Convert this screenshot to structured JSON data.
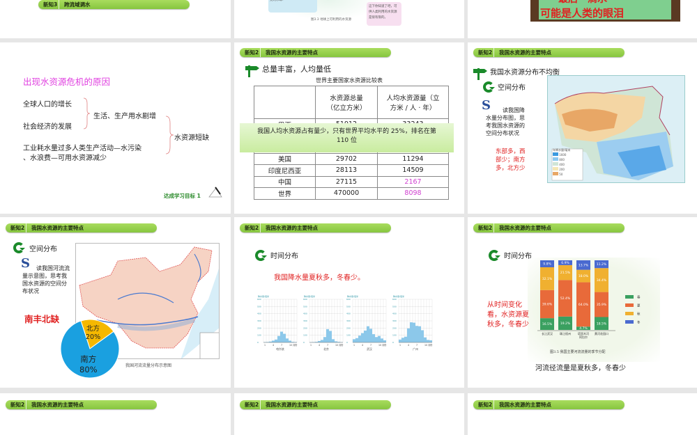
{
  "colors": {
    "pill": "#92d050",
    "accent_red": "#e02020",
    "title_pink": "#e040e0",
    "magenta": "#d040d0",
    "north": "#f5b800",
    "south": "#1aa0e0"
  },
  "top_row": {
    "slide1": {
      "section_num": "新知3",
      "section_title": "跨流域调水"
    },
    "slide2": {
      "bubble_blue": "千米的水，是蔚蓝色宝石一样漂亮的水球!",
      "bubble_pink": "这下你知道了吧，可供人类利用的水资源是很有限的。",
      "caption": "图3.3 地球上可利用的水资源"
    },
    "slide3": {
      "photo_line1": "最后一滴水",
      "photo_line2": "可能是人类的眼泪"
    }
  },
  "header": {
    "section_num": "新知2",
    "section_title": "我国水资源的主要特点"
  },
  "crisis": {
    "title": "出现水资源危机的原因",
    "cause1": "全球人口的增长",
    "cause2": "社会经济的发展",
    "result1": "生活、生产用水剧增",
    "cause3a": "工业耗水量过多人类生产活动—水污染",
    "cause3b": "、水浪费—可用水资源减少",
    "result2": "水资源短缺",
    "footer": "达成学习目标",
    "footer_num": "1"
  },
  "total": {
    "heading": "总量丰富，人均量低",
    "caption": "世界主要国家水资源比较表",
    "col1": "水资源总量（亿立方米）",
    "col2": "人均水资源量（立方米 / 人 · 年）",
    "rows": [
      {
        "c": "巴西",
        "t": "51912",
        "p": "33243"
      },
      {
        "c": "美国",
        "t": "29702",
        "p": "11294"
      },
      {
        "c": "印度尼西亚",
        "t": "28113",
        "p": "14509"
      },
      {
        "c": "中国",
        "t": "27115",
        "p": "2167"
      },
      {
        "c": "世界",
        "t": "470000",
        "p": "8098"
      }
    ],
    "note": "我国人均水资源占有量少，只有世界平均水平的 25%，排名在第 110 位"
  },
  "uneven": {
    "heading": "我国水资源分布不均衡",
    "sub": "空间分布",
    "question": "读我国降水量分布图，思考我国水资源的空间分布状况",
    "answer": "东部多，西部少；南方多，北方少",
    "legend_title": "年降水量/毫米",
    "legend": [
      "1600",
      "800",
      "400",
      "200",
      "50"
    ]
  },
  "space": {
    "sub": "空间分布",
    "question": "读我国河流流量示意图，思考我国水资源的空间分布状况",
    "answer": "南丰北缺",
    "map_caption": "我国河流流量分布示意图",
    "pie": [
      {
        "label": "北方",
        "pct": "20%",
        "value": 20
      },
      {
        "label": "南方",
        "pct": "80%",
        "value": 80
      }
    ]
  },
  "time1": {
    "sub": "时间分布",
    "answer": "我国降水量夏秋多，冬春少。",
    "ylabel": "降水量/毫米",
    "yticks": [
      "0",
      "100",
      "200",
      "300",
      "400",
      "500",
      "600"
    ],
    "xticks": [
      "1",
      "4",
      "7",
      "10 月份"
    ],
    "charts": [
      {
        "city": "哈尔滨",
        "values": [
          4,
          6,
          12,
          25,
          40,
          90,
          150,
          120,
          55,
          25,
          8,
          5
        ]
      },
      {
        "city": "北京",
        "values": [
          3,
          5,
          8,
          20,
          35,
          75,
          185,
          160,
          45,
          15,
          8,
          3
        ]
      },
      {
        "city": "武汉",
        "values": [
          45,
          60,
          95,
          130,
          165,
          225,
          190,
          115,
          75,
          90,
          55,
          30
        ]
      },
      {
        "city": "广州",
        "values": [
          40,
          65,
          80,
          195,
          280,
          275,
          230,
          225,
          170,
          70,
          35,
          30
        ]
      }
    ]
  },
  "time2": {
    "sub": "时间分布",
    "answer": "从时间变化看，水资源夏秋多，冬春少",
    "caption": "图3.5 我国主要河流流量的季节分配",
    "conclusion": "河流径流量是夏秋多，冬春少",
    "legend": [
      {
        "name": "春",
        "color": "#3aa060"
      },
      {
        "name": "夏",
        "color": "#e86a3a"
      },
      {
        "name": "秋",
        "color": "#f0b030"
      },
      {
        "name": "冬",
        "color": "#4a6ad0"
      }
    ],
    "rivers": [
      {
        "name": "长江武汉",
        "spring": 16.5,
        "summer": 39.6,
        "autumn": 32.1,
        "winter": 9.8
      },
      {
        "name": "珠江梧州",
        "spring": 19.2,
        "summer": 52.4,
        "autumn": 21.5,
        "winter": 6.9
      },
      {
        "name": "塔里木河阿拉尔",
        "spring": 4.7,
        "summer": 64.0,
        "autumn": 18.0,
        "winter": 13.7
      },
      {
        "name": "黄河花园口",
        "spring": 18.5,
        "summer": 35.9,
        "autumn": 34.4,
        "winter": 11.2
      }
    ]
  }
}
